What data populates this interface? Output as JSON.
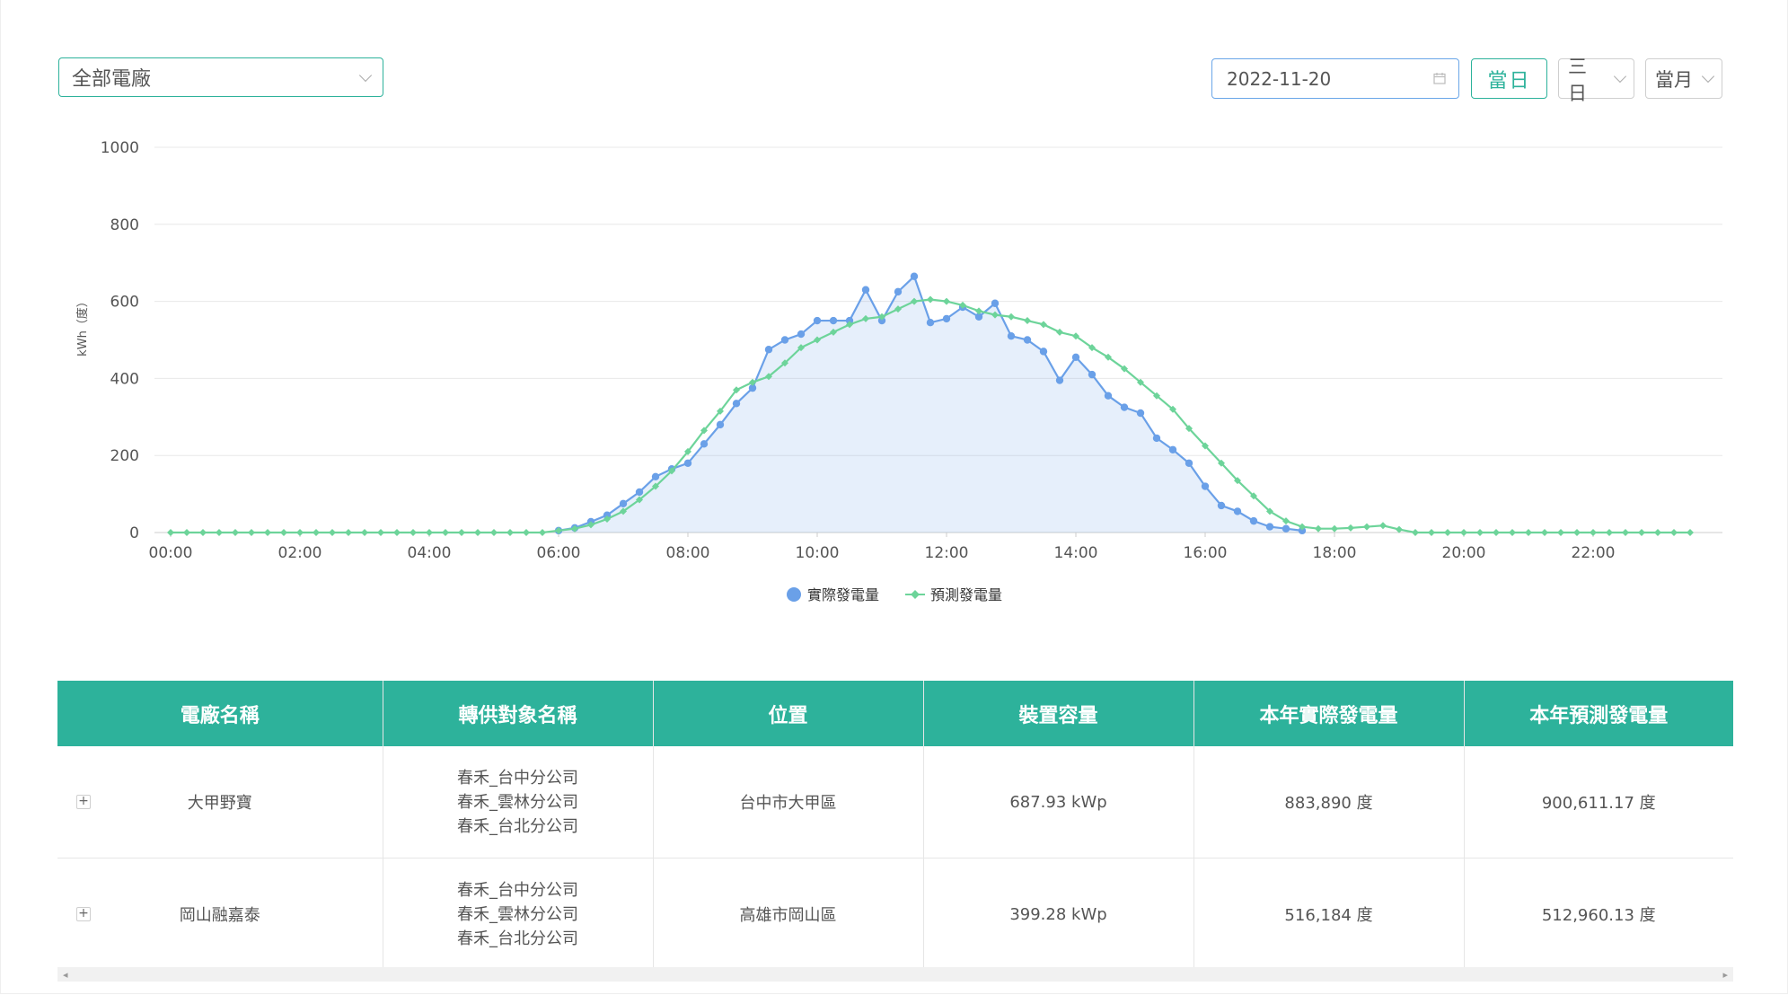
{
  "toolbar": {
    "plant_select": "全部電廠",
    "date_value": "2022-11-20",
    "today_button": "當日",
    "range_select": "三日",
    "period_select": "當月"
  },
  "colors": {
    "accent": "#2db29b",
    "actual": "#6aa0e8",
    "forecast": "#6dd49a"
  },
  "chart_data": {
    "type": "line",
    "xlabel": "",
    "ylabel": "kWh（度）",
    "ylim": [
      0,
      1000
    ],
    "yticks": [
      "0",
      "200",
      "400",
      "600",
      "800",
      "1000"
    ],
    "xticks": [
      "00:00",
      "02:00",
      "04:00",
      "06:00",
      "08:00",
      "10:00",
      "12:00",
      "14:00",
      "16:00",
      "18:00",
      "20:00",
      "22:00"
    ],
    "x_interval_minutes": 15,
    "legend": "bottom-center",
    "area_fill_series": "實際發電量",
    "series": [
      {
        "name": "實際發電量",
        "color": "#6aa0e8",
        "start": "06:00",
        "values": [
          5,
          12,
          28,
          45,
          75,
          105,
          145,
          165,
          180,
          230,
          280,
          335,
          375,
          475,
          500,
          515,
          550,
          550,
          550,
          630,
          550,
          625,
          665,
          545,
          555,
          585,
          560,
          595,
          510,
          500,
          470,
          395,
          455,
          410,
          355,
          325,
          310,
          245,
          215,
          180,
          120,
          70,
          55,
          30,
          15,
          10,
          5
        ]
      },
      {
        "name": "預測發電量",
        "color": "#6dd49a",
        "start": "00:00",
        "values": [
          0,
          0,
          0,
          0,
          0,
          0,
          0,
          0,
          0,
          0,
          0,
          0,
          0,
          0,
          0,
          0,
          0,
          0,
          0,
          0,
          0,
          0,
          0,
          0,
          5,
          10,
          20,
          35,
          55,
          85,
          120,
          160,
          210,
          265,
          315,
          370,
          390,
          405,
          440,
          480,
          500,
          520,
          540,
          555,
          560,
          580,
          600,
          605,
          600,
          590,
          575,
          565,
          560,
          550,
          540,
          520,
          510,
          480,
          455,
          425,
          390,
          355,
          320,
          270,
          225,
          180,
          135,
          95,
          55,
          30,
          15,
          10,
          10,
          12,
          15,
          18,
          8,
          0,
          0,
          0,
          0,
          0,
          0,
          0,
          0,
          0,
          0,
          0,
          0,
          0,
          0,
          0,
          0,
          0,
          0
        ]
      }
    ]
  },
  "table": {
    "headers": [
      "電廠名稱",
      "轉供對象名稱",
      "位置",
      "裝置容量",
      "本年實際發電量",
      "本年預測發電量"
    ],
    "rows": [
      {
        "expand": "+",
        "name": "大甲野寶",
        "targets": [
          "春禾_台中分公司",
          "春禾_雲林分公司",
          "春禾_台北分公司"
        ],
        "location": "台中市大甲區",
        "capacity": "687.93 kWp",
        "actual": "883,890 度",
        "forecast": "900,611.17 度"
      },
      {
        "expand": "+",
        "name": "岡山融嘉泰",
        "targets": [
          "春禾_台中分公司",
          "春禾_雲林分公司",
          "春禾_台北分公司"
        ],
        "location": "高雄市岡山區",
        "capacity": "399.28 kWp",
        "actual": "516,184 度",
        "forecast": "512,960.13 度"
      }
    ]
  }
}
